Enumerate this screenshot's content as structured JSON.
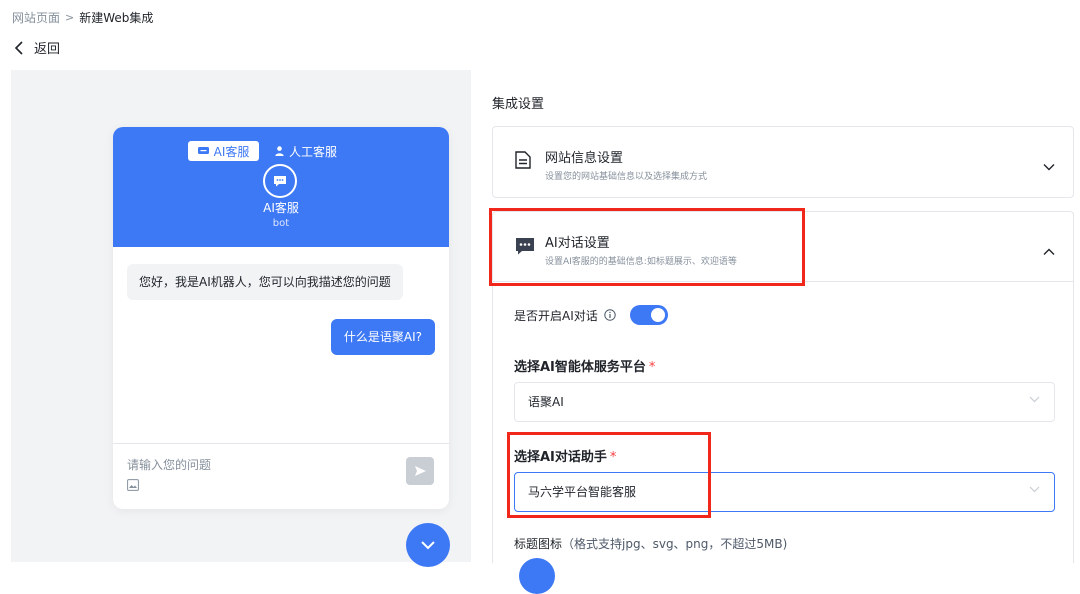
{
  "breadcrumb": {
    "parent": "网站页面",
    "separator": ">",
    "current": "新建Web集成"
  },
  "back": {
    "label": "返回"
  },
  "preview": {
    "tabs": [
      {
        "label": "AI客服",
        "active": true
      },
      {
        "label": "人工客服",
        "active": false
      }
    ],
    "bot_name": "AI客服",
    "bot_sub": "bot",
    "bot_message": "您好，我是AI机器人，您可以向我描述您的问题",
    "user_message": "什么是语聚AI?",
    "input_placeholder": "请输入您的问题",
    "accent": "#3d78f5"
  },
  "settings": {
    "title": "集成设置",
    "website_card": {
      "title": "网站信息设置",
      "desc": "设置您的网站基础信息以及选择集成方式"
    },
    "ai_card": {
      "title": "AI对话设置",
      "desc": "设置AI客服的的基础信息:如标题展示、欢迎语等",
      "enable_label": "是否开启AI对话",
      "enabled": true,
      "platform_label": "选择AI智能体服务平台",
      "platform_value": "语聚AI",
      "assistant_label": "选择AI对话助手",
      "assistant_value": "马六学平台智能客服",
      "icon_label": "标题图标",
      "icon_hint": "（格式支持jpg、svg、png，不超过5MB)",
      "required_mark": "*"
    }
  },
  "colors": {
    "accent": "#3d78f5",
    "highlight": "#f2271c",
    "required": "#f53f3f"
  }
}
